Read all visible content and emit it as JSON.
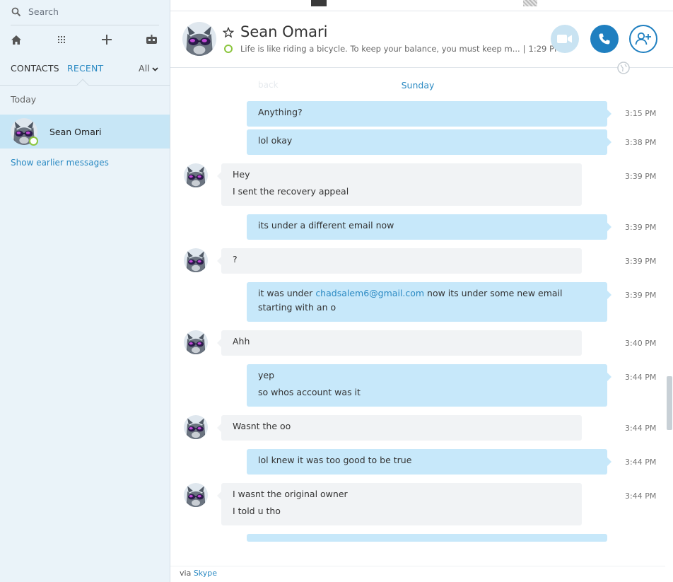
{
  "search": {
    "placeholder": "Search"
  },
  "tabs": {
    "contacts": "CONTACTS",
    "recent": "RECENT",
    "filter": "All"
  },
  "sidebar": {
    "section_label": "Today",
    "contact_name": "Sean Omari",
    "show_earlier": "Show earlier messages"
  },
  "header": {
    "name": "Sean Omari",
    "mood": "Life is like riding a bicycle. To keep your balance, you must keep m...",
    "separator": "|",
    "time": "1:29 PM"
  },
  "conversation": {
    "ghost_label": "back",
    "day_label": "Sunday",
    "messages": [
      {
        "dir": "out",
        "lines": [
          "Anything?"
        ],
        "time": "3:15 PM"
      },
      {
        "dir": "out",
        "lines": [
          "lol okay"
        ],
        "time": "3:38 PM"
      },
      {
        "dir": "in",
        "lines": [
          "Hey",
          "I sent the recovery appeal"
        ],
        "time": "3:39 PM"
      },
      {
        "dir": "out",
        "lines": [
          "its under a different email now"
        ],
        "time": "3:39 PM"
      },
      {
        "dir": "in",
        "lines": [
          "?"
        ],
        "time": "3:39 PM"
      },
      {
        "dir": "out",
        "text_before": "it was under ",
        "link": "chadsalem6@gmail.com",
        "text_after": " now its under some new email starting with an o",
        "time": "3:39 PM"
      },
      {
        "dir": "in",
        "lines": [
          "Ahh"
        ],
        "time": "3:40 PM"
      },
      {
        "dir": "out",
        "lines": [
          "yep",
          "so whos account was it"
        ],
        "time": "3:44 PM"
      },
      {
        "dir": "in",
        "lines": [
          "Wasnt the oo"
        ],
        "time": "3:44 PM"
      },
      {
        "dir": "out",
        "lines": [
          "lol knew it was too good to be true"
        ],
        "time": "3:44 PM"
      },
      {
        "dir": "in",
        "lines": [
          "I wasnt the original owner",
          "I told u tho"
        ],
        "time": "3:44 PM"
      }
    ]
  },
  "footer": {
    "via": "via",
    "brand": "Skype"
  },
  "colors": {
    "accent": "#2b8ac3",
    "call_button": "#1f7fc0",
    "outgoing_bubble": "#c7e8fa",
    "incoming_bubble": "#f1f3f5",
    "presence_online": "#8cc63f",
    "selected_row": "#c7e6f6"
  },
  "icons": [
    "search-icon",
    "home-icon",
    "dialpad-icon",
    "plus-icon",
    "bot-icon",
    "chevron-down-icon",
    "star-icon",
    "video-call-icon",
    "phone-icon",
    "add-contact-icon",
    "globe-icon"
  ]
}
